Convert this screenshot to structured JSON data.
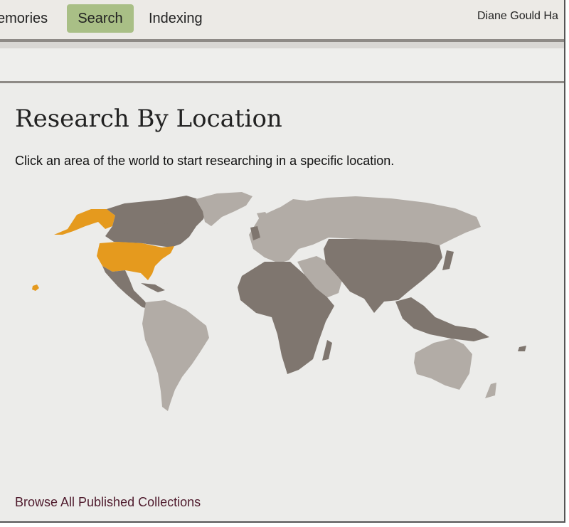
{
  "nav": {
    "memories_label": "emories",
    "search_label": "Search",
    "indexing_label": "Indexing",
    "user_name": "Diane Gould Ha"
  },
  "main": {
    "title": "Research By Location",
    "subtitle": "Click an area of the world to start researching in a specific location.",
    "browse_link": "Browse All Published Collections"
  },
  "map": {
    "selected_region": "United States",
    "colors": {
      "selected": "#e59a1e",
      "dark": "#7f766f",
      "light": "#b2aca6"
    }
  }
}
